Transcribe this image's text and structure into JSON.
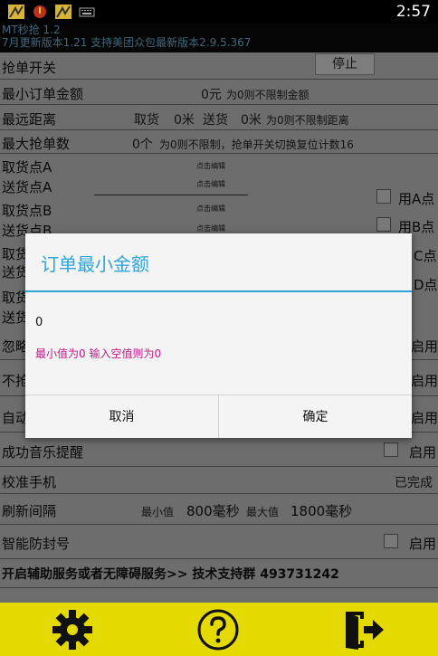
{
  "status": {
    "time": "2:57"
  },
  "header": {
    "title": "MT秒抢 1.2",
    "subtitle": "7月更新版本1.21 支持美团众包最新版本2.9.5.367"
  },
  "toggle": {
    "label": "抢单开关",
    "button": "停止"
  },
  "min_amount": {
    "label": "最小订单金额",
    "value": "0元",
    "note": "为0则不限制金额"
  },
  "distance": {
    "label": "最远距离",
    "pickup_label": "取货",
    "pickup_value": "0米",
    "delivery_label": "送货",
    "delivery_value": "0米",
    "note": "为0则不限制距离"
  },
  "max_grab": {
    "label": "最大抢单数",
    "value": "0个",
    "note": "为0则不限制，抢单开关切换复位计数16"
  },
  "locations": {
    "pickup_a": "取货点A",
    "delivery_a": "送货点A",
    "pickup_b": "取货点B",
    "delivery_b": "送货点B",
    "pickup_c": "取货",
    "delivery_c": "送货",
    "pickup_d": "取货",
    "delivery_d": "送货",
    "edit_hint": "点击编辑",
    "use_a": "用A点",
    "use_b": "用B点",
    "use_c": "C点",
    "use_d": "D点"
  },
  "rows": {
    "ignore": "忽略",
    "no_grab": "不抢",
    "auto": "自动",
    "enable": "启用",
    "music": "成功音乐提醒",
    "calibrate": "校准手机",
    "calibrate_status": "已完成",
    "refresh": "刷新间隔",
    "refresh_min_label": "最小值",
    "refresh_min": "800毫秒",
    "refresh_max_label": "最大值",
    "refresh_max": "1800毫秒",
    "anti_ban": "智能防封号",
    "service": "开启辅助服务或者无障碍服务>>  技术支持群 493731242"
  },
  "dialog": {
    "title": "订单最小金额",
    "value": "0",
    "hint": "最小值为0 输入空值则为0",
    "cancel": "取消",
    "confirm": "确定"
  },
  "colors": {
    "accent": "#2fa4d6",
    "hint": "#c21a8c",
    "bottom_bar": "#e4d900"
  }
}
